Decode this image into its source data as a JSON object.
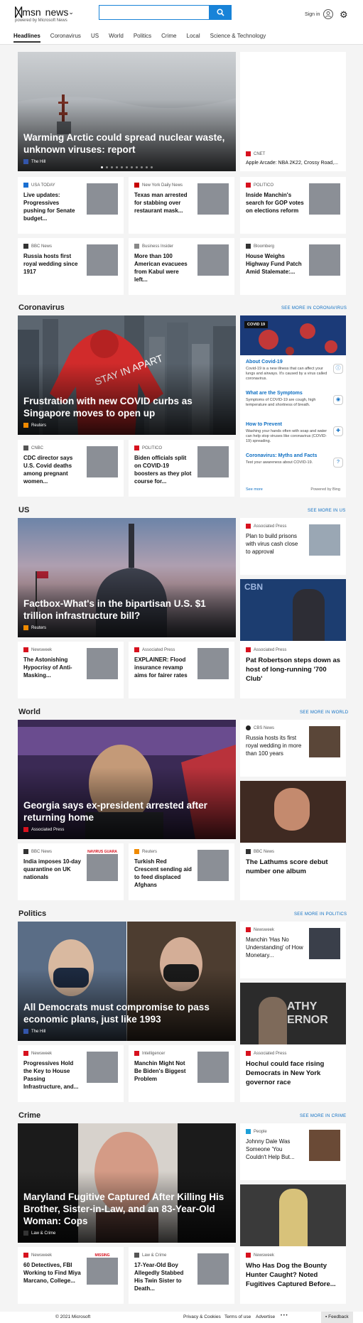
{
  "header": {
    "logo": "msn",
    "section_name": "news",
    "chevron": "⌄",
    "powered": "powered by Microsoft News",
    "search_value": "",
    "sign_in": "Sign in",
    "search_icon": "search-icon",
    "gear_icon": "gear-icon",
    "avatar_icon": "user-avatar-icon"
  },
  "nav": {
    "items": [
      "Headlines",
      "Coronavirus",
      "US",
      "World",
      "Politics",
      "Crime",
      "Local",
      "Science & Technology"
    ],
    "active": "Headlines"
  },
  "headlines": {
    "hero": {
      "title": "Warming Arctic could spread nuclear waste, unknown viruses: report",
      "source": "The Hill"
    },
    "side": {
      "source": "CNET",
      "title": "Apple Arcade: NBA 2K22, Crossy Road,..."
    },
    "cards": [
      {
        "source": "USA TODAY",
        "title": "Live updates: Progressives pushing for Senate budget...",
        "icon_color": "#1a6fd1"
      },
      {
        "source": "New York Daily News",
        "title": "Texas man arrested for stabbing over restaurant mask...",
        "icon_color": "#c80000"
      },
      {
        "source": "POLITICO",
        "title": "Inside Manchin's search for GOP votes on elections reform",
        "icon_color": "#d7111e"
      },
      {
        "source": "BBC News",
        "title": "Russia hosts first royal wedding since 1917",
        "icon_color": "#333333"
      },
      {
        "source": "Business Insider",
        "title": "More than 100 American evacuees from Kabul were left...",
        "icon_color": "#888888"
      },
      {
        "source": "Bloomberg",
        "title": "House Weighs Highway Fund Patch Amid Stalemate:...",
        "icon_color": "#333333"
      }
    ]
  },
  "coronavirus": {
    "label": "Coronavirus",
    "more": "SEE MORE IN CORONAVIRUS",
    "hero": {
      "title": "Frustration with new COVID curbs as Singapore moves to open up",
      "source": "Reuters"
    },
    "panel": {
      "tag": "COVID 19",
      "items": [
        {
          "title": "About Covid-19",
          "desc": "Covid-19 is a new illness that can affect your lungs and airways. It's caused by a virus called coronavirus."
        },
        {
          "title": "What are the Symptoms",
          "desc": "Symptoms of COVID-19 are cough, high temperature and shortness of breath."
        },
        {
          "title": "How to Prevent",
          "desc": "Washing your hands often with soap and water can help stop viruses like coronavirus (COVID-19) spreading."
        },
        {
          "title": "Coronavirus: Myths and Facts",
          "desc": "Test your awareness about COVID-19."
        }
      ],
      "see_more": "See more",
      "powered": "Powered by Bing"
    },
    "cards": [
      {
        "source": "CNBC",
        "title": "CDC director says U.S. Covid deaths among pregnant women...",
        "icon_color": "#555555"
      },
      {
        "source": "POLITICO",
        "title": "Biden officials split on COVID-19 boosters as they plot course for...",
        "icon_color": "#d7111e"
      }
    ]
  },
  "us": {
    "label": "US",
    "more": "SEE MORE IN US",
    "hero": {
      "title": "Factbox-What's in the bipartisan U.S. $1 trillion infrastructure bill?",
      "source": "Reuters"
    },
    "side_top": {
      "source": "Associated Press",
      "title": "Plan to build prisons with virus cash close to approval",
      "icon_color": "#d7111e"
    },
    "side_big": {
      "source": "Associated Press",
      "title": "Pat Robertson steps down as host of long-running '700 Club'",
      "icon_color": "#d7111e"
    },
    "side_big_banner": "CBN",
    "cards": [
      {
        "source": "Newsweek",
        "title": "The Astonishing Hypocrisy of Anti-Masking...",
        "icon_color": "#d7111e"
      },
      {
        "source": "Associated Press",
        "title": "EXPLAINER: Flood insurance revamp aims for fairer rates",
        "icon_color": "#d7111e"
      }
    ]
  },
  "world": {
    "label": "World",
    "more": "SEE MORE IN WORLD",
    "hero": {
      "title": "Georgia says ex-president arrested after returning home",
      "source": "Associated Press"
    },
    "side_top": {
      "source": "CBS News",
      "title": "Russia hosts its first royal wedding in more than 100 years",
      "icon_color": "#222222"
    },
    "side_big": {
      "source": "BBC News",
      "title": "The Lathums score debut number one album",
      "icon_color": "#333333"
    },
    "cards": [
      {
        "source": "BBC News",
        "title": "India imposes 10-day quarantine on UK nationals",
        "icon_color": "#333333",
        "banner": "NAVIRUS GUARA"
      },
      {
        "source": "Reuters",
        "title": "Turkish Red Crescent sending aid to feed displaced Afghans",
        "icon_color": "#f08a00"
      }
    ]
  },
  "politics": {
    "label": "Politics",
    "more": "SEE MORE IN POLITICS",
    "hero": {
      "title": "All Democrats must compromise to pass economic plans, just like 1993",
      "source": "The Hill"
    },
    "side_top": {
      "source": "Newsweek",
      "title": "Manchin 'Has No Understanding' of How Monetary...",
      "icon_color": "#d7111e"
    },
    "side_big": {
      "source": "Associated Press",
      "title": "Hochul could face rising Democrats in New York governor race",
      "icon_color": "#d7111e"
    },
    "side_big_banner": "ATHY ERNOR",
    "cards": [
      {
        "source": "Newsweek",
        "title": "Progressives Hold the Key to House Passing Infrastructure, and...",
        "icon_color": "#d7111e"
      },
      {
        "source": "Intelligencer",
        "title": "Manchin Might Not Be Biden's Biggest Problem",
        "icon_color": "#d7111e"
      }
    ]
  },
  "crime": {
    "label": "Crime",
    "more": "SEE MORE IN CRIME",
    "hero": {
      "title": "Maryland Fugitive Captured After Killing His Brother, Sister-in-Law, and an 83-Year-Old Woman: Cops",
      "source": "Law & Crime"
    },
    "side_top": {
      "source": "People",
      "title": "Johnny Dale Was Someone 'You Couldn't Help But...",
      "icon_color": "#1ea0d8"
    },
    "side_big": {
      "source": "Newsweek",
      "title": "Who Has Dog the Bounty Hunter Caught? Noted Fugitives Captured Before...",
      "icon_color": "#d7111e"
    },
    "cards": [
      {
        "source": "Newsweek",
        "title": "60 Detectives, FBI Working to Find Miya Marcano, College...",
        "icon_color": "#d7111e",
        "banner": "MISSING"
      },
      {
        "source": "Law & Crime",
        "title": "17-Year-Old Boy Allegedly Stabbed His Twin Sister to Death...",
        "icon_color": "#555555"
      }
    ]
  },
  "footer": {
    "copyright": "© 2021 Microsoft",
    "links": [
      "Privacy & Cookies",
      "Terms of use",
      "Advertise"
    ],
    "ellipsis": "• • •",
    "feedback": "Feedback"
  }
}
